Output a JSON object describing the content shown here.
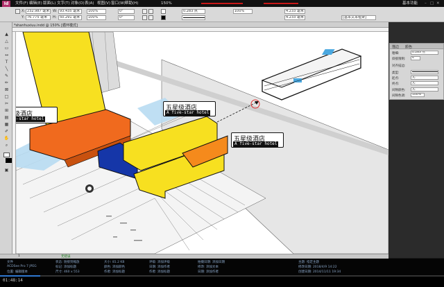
{
  "app": {
    "logo": "Id",
    "menus": [
      "文件(F)",
      "编辑(E)",
      "版面(L)",
      "文字(T)",
      "对象(O)",
      "表(A)",
      "视图(V)",
      "窗口(W)",
      "帮助(H)"
    ],
    "zoom": "150%",
    "workspace": "基本功能"
  },
  "control": {
    "x": "232.987 毫米",
    "y": "76.775 毫米",
    "w": "93.435 毫米",
    "h": "50.291 毫米",
    "scale_x": "100%",
    "scale_y": "100%",
    "angle": "0°",
    "shear": "0°",
    "stroke": "0.283 点",
    "opacity": "100%",
    "font_size": "4.233 毫米",
    "frame_fit": "[基本文本框架]"
  },
  "document": {
    "tab": "*shanhuxiuu.indd @ 150% [循环模式]"
  },
  "callouts": {
    "left": {
      "zh": "级酒店",
      "en": "e-star hotel"
    },
    "center": {
      "zh": "五星级酒店",
      "en": "A five-star hotel"
    },
    "right": {
      "zh": "五星级酒店",
      "en": "A five-star hotel"
    }
  },
  "stroke_panel": {
    "tabs": [
      "描边",
      "颜色"
    ],
    "weight_label": "粗细:",
    "weight": "0.283 点",
    "miter_label": "斜接限制:",
    "miter": "4",
    "align_label": "对齐描边:",
    "type_label": "类型:",
    "start_label": "起点:",
    "start": "无",
    "end_label": "终点:",
    "end": "无",
    "gap_color_label": "间隙颜色:",
    "gap_color": "无",
    "gap_tint_label": "间隙色调:",
    "gap_tint": "100%"
  },
  "status": {
    "page": "1",
    "preflight": "无错误"
  },
  "info": {
    "col1": [
      "文件",
      "ACDSee Pro 7 JPEG",
      "位置: 编辑版本"
    ],
    "col2": [
      "状态: 链接到缩放",
      "标记: 添加标题",
      "尺寸: 460 x 553"
    ],
    "col3": [
      "大小: 81.2 KB",
      "颜色: 添加颜色",
      "作者: 添加标题"
    ],
    "col4": [
      "评级: 添加评级",
      "日期: 添加作者",
      "作者: 添加标题"
    ],
    "col5": [
      "拍摄日期: 添加日期",
      "修改: 添加文本",
      "日期: 添加作者"
    ],
    "col6": [
      "主题: 指定主题",
      "修改日期: 2018/4/9 14:22",
      "创建日期: 2014/11/11 19:34"
    ]
  },
  "video": {
    "time": "01:48:14",
    "progress": 0.09
  },
  "colors": {
    "yellow": "#f7e020",
    "orange": "#f06a1e",
    "blue": "#1536a8",
    "glass": "#b8dcf2"
  }
}
